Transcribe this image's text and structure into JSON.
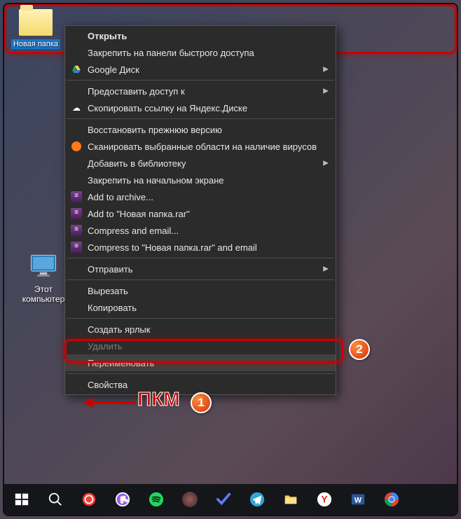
{
  "desktop": {
    "computer_label": "Этот\nкомпьютер",
    "folder_label": "Новая папка"
  },
  "context_menu": {
    "open": "Открыть",
    "pin_quick": "Закрепить на панели быстрого доступа",
    "google_drive": "Google Диск",
    "grant_access": "Предоставить доступ к",
    "yandex_copy": "Скопировать ссылку на Яндекс.Диске",
    "restore_prev": "Восстановить прежнюю версию",
    "avast_scan": "Сканировать выбранные области на наличие вирусов",
    "add_library": "Добавить в библиотеку",
    "pin_start": "Закрепить на начальном экране",
    "add_archive": "Add to archive...",
    "add_rar": "Add to \"Новая папка.rar\"",
    "compress_email": "Compress and email...",
    "compress_rar_email": "Compress to \"Новая папка.rar\" and email",
    "send_to": "Отправить",
    "cut": "Вырезать",
    "copy": "Копировать",
    "create_shortcut": "Создать ярлык",
    "delete": "Удалить",
    "rename": "Переименовать",
    "properties": "Свойства"
  },
  "annotations": {
    "badge1": "1",
    "badge2": "2",
    "pkm": "ПКМ"
  },
  "taskbar": {
    "items": [
      {
        "name": "start-button",
        "icon": "windows"
      },
      {
        "name": "search-button",
        "icon": "search"
      },
      {
        "name": "pocket-casts",
        "icon": "circle-ring"
      },
      {
        "name": "itunes",
        "icon": "music"
      },
      {
        "name": "spotify",
        "icon": "spotify"
      },
      {
        "name": "record",
        "icon": "record"
      },
      {
        "name": "todo",
        "icon": "check"
      },
      {
        "name": "telegram",
        "icon": "telegram"
      },
      {
        "name": "file-explorer",
        "icon": "folder"
      },
      {
        "name": "yandex-browser",
        "icon": "y"
      },
      {
        "name": "word",
        "icon": "word"
      },
      {
        "name": "chrome",
        "icon": "chrome"
      }
    ]
  }
}
